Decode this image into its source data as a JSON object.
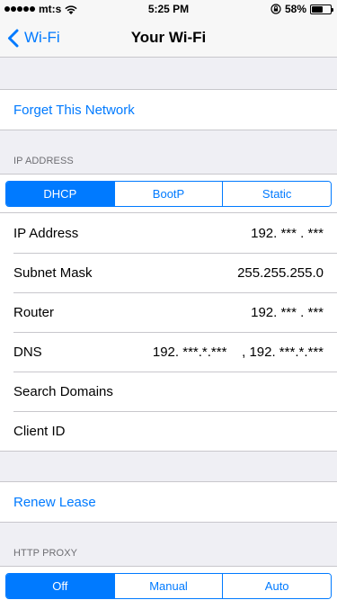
{
  "status_bar": {
    "carrier": "mt:s",
    "time": "5:25 PM",
    "battery": "58%",
    "battery_level": 0.58
  },
  "nav": {
    "back_label": "Wi-Fi",
    "title": "Your Wi-Fi"
  },
  "forget_network": "Forget This Network",
  "ip_address": {
    "header": "IP ADDRESS",
    "segments": [
      "DHCP",
      "BootP",
      "Static"
    ],
    "selected": "DHCP",
    "rows": [
      {
        "label": "IP Address",
        "value": "192. *** . ***"
      },
      {
        "label": "Subnet Mask",
        "value": "255.255.255.0"
      },
      {
        "label": "Router",
        "value": "192. *** . ***"
      },
      {
        "label": "DNS",
        "value": "192. ***.*.***    , 192. ***.*.***"
      },
      {
        "label": "Search Domains",
        "value": ""
      },
      {
        "label": "Client ID",
        "value": ""
      }
    ]
  },
  "renew_lease": "Renew Lease",
  "http_proxy": {
    "header": "HTTP PROXY",
    "segments": [
      "Off",
      "Manual",
      "Auto"
    ],
    "selected": "Off"
  },
  "colors": {
    "accent": "#007aff",
    "background": "#efeff4",
    "separator": "#c8c7cc"
  }
}
